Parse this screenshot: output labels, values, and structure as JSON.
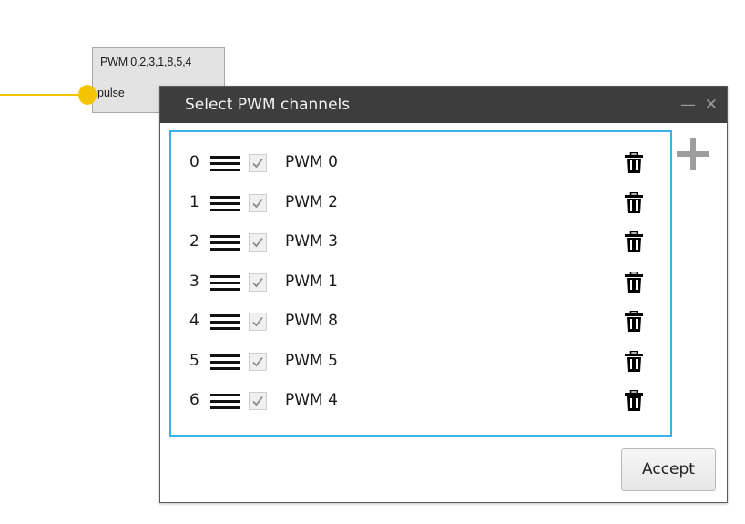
{
  "canvas": {
    "block": {
      "title": "PWM 0,2,3,1,8,5,4",
      "port_label": "pulse",
      "wire_color": "#f5c400"
    }
  },
  "dialog": {
    "title": "Select PWM channels",
    "minimize_icon": "minimize-icon",
    "close_icon": "close-icon",
    "add_icon": "plus-icon",
    "accept_label": "Accept",
    "list_border_color": "#38b3e8",
    "channels": [
      {
        "index": "0",
        "name": "PWM 0",
        "checked": true
      },
      {
        "index": "1",
        "name": "PWM 2",
        "checked": true
      },
      {
        "index": "2",
        "name": "PWM 3",
        "checked": true
      },
      {
        "index": "3",
        "name": "PWM 1",
        "checked": true
      },
      {
        "index": "4",
        "name": "PWM 8",
        "checked": true
      },
      {
        "index": "5",
        "name": "PWM 5",
        "checked": true
      },
      {
        "index": "6",
        "name": "PWM 4",
        "checked": true
      }
    ]
  }
}
